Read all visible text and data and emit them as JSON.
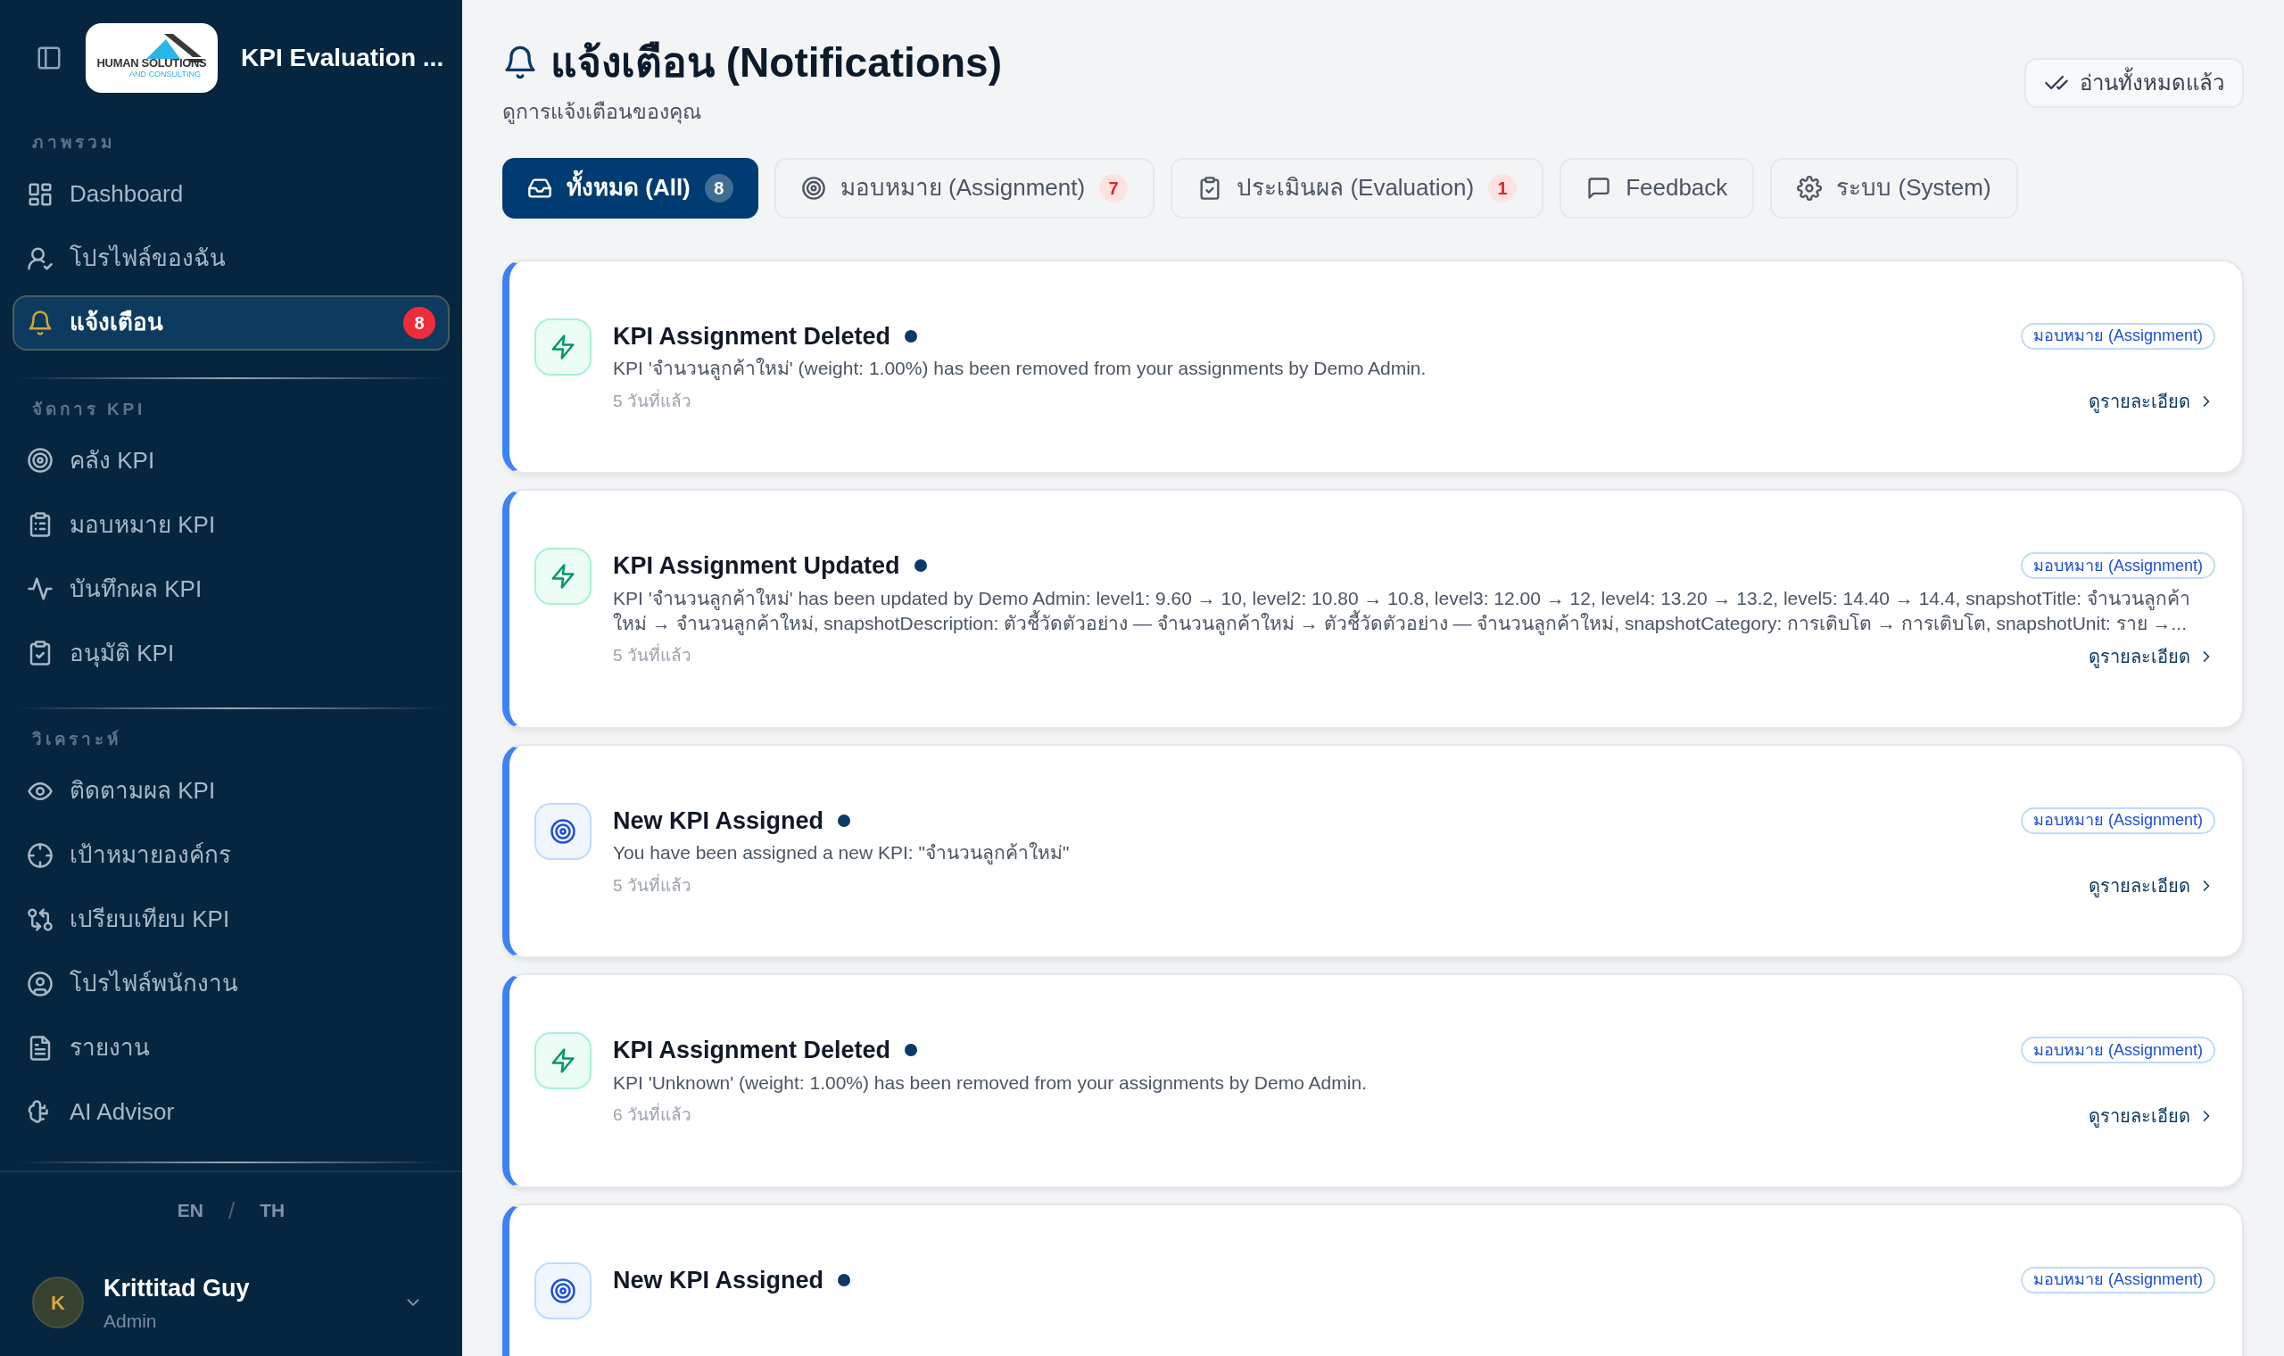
{
  "sidebar": {
    "logo": {
      "text": "HUMAN SOLUTIONS",
      "subtext": "AND CONSULTING"
    },
    "app_title": "KPI Evaluation ...",
    "sections": [
      {
        "label": "ภาพรวม",
        "items": [
          {
            "label": "Dashboard",
            "selected": false
          },
          {
            "label": "โปรไฟล์ของฉัน",
            "selected": false
          },
          {
            "label": "แจ้งเตือน",
            "selected": true,
            "badge": "8"
          }
        ]
      },
      {
        "label": "จัดการ KPI",
        "items": [
          {
            "label": "คลัง KPI",
            "selected": false
          },
          {
            "label": "มอบหมาย KPI",
            "selected": false
          },
          {
            "label": "บันทึกผล KPI",
            "selected": false
          },
          {
            "label": "อนุมัติ KPI",
            "selected": false
          }
        ]
      },
      {
        "label": "วิเคราะห์",
        "items": [
          {
            "label": "ติดตามผล KPI",
            "selected": false
          },
          {
            "label": "เป้าหมายองค์กร",
            "selected": false
          },
          {
            "label": "เปรียบเทียบ KPI",
            "selected": false
          },
          {
            "label": "โปรไฟล์พนักงาน",
            "selected": false
          },
          {
            "label": "รายงาน",
            "selected": false
          },
          {
            "label": "AI Advisor",
            "selected": false
          }
        ]
      }
    ],
    "languages": [
      {
        "label": "EN"
      },
      {
        "label": "/"
      },
      {
        "label": "TH"
      }
    ],
    "user": {
      "initial": "K",
      "name": "Krittitad Guy",
      "role": "Admin"
    }
  },
  "header": {
    "title": "แจ้งเตือน (Notifications)",
    "subtitle": "ดูการแจ้งเตือนของคุณ",
    "mark_all_button": "อ่านทั้งหมดแล้ว"
  },
  "tabs": [
    {
      "label": "ทั้งหมด (All)",
      "count": "8",
      "selected": true
    },
    {
      "label": "มอบหมาย (Assignment)",
      "count": "7",
      "selected": false
    },
    {
      "label": "ประเมินผล (Evaluation)",
      "count": "1",
      "selected": false
    },
    {
      "label": "Feedback",
      "selected": false
    },
    {
      "label": "ระบบ (System)",
      "selected": false
    }
  ],
  "notifications": [
    {
      "kind": "change",
      "title": "KPI Assignment Deleted",
      "unread": true,
      "description": "KPI 'จำนวนลูกค้าใหม่' (weight: 1.00%) has been removed from your assignments by Demo Admin.",
      "time": "5 วันที่แล้ว",
      "tag": "มอบหมาย (Assignment)",
      "link": "ดูรายละเอียด"
    },
    {
      "kind": "change",
      "title": "KPI Assignment Updated",
      "unread": true,
      "description": "KPI 'จำนวนลูกค้าใหม่' has been updated by Demo Admin: level1: 9.60 → 10, level2: 10.80 → 10.8, level3: 12.00 → 12, level4: 13.20 → 13.2, level5: 14.40 → 14.4, snapshotTitle: จำนวนลูกค้าใหม่ → จำนวนลูกค้าใหม่, snapshotDescription: ตัวชี้วัดตัวอย่าง — จำนวนลูกค้าใหม่ → ตัวชี้วัดตัวอย่าง — จำนวนลูกค้าใหม่, snapshotCategory: การเติบโต → การเติบโต, snapshotUnit: ราย →...",
      "time": "5 วันที่แล้ว",
      "tag": "มอบหมาย (Assignment)",
      "link": "ดูรายละเอียด"
    },
    {
      "kind": "new",
      "title": "New KPI Assigned",
      "unread": true,
      "description": "You have been assigned a new KPI: \"จำนวนลูกค้าใหม่\"",
      "time": "5 วันที่แล้ว",
      "tag": "มอบหมาย (Assignment)",
      "link": "ดูรายละเอียด"
    },
    {
      "kind": "change",
      "title": "KPI Assignment Deleted",
      "unread": true,
      "description": "KPI 'Unknown' (weight: 1.00%) has been removed from your assignments by Demo Admin.",
      "time": "6 วันที่แล้ว",
      "tag": "มอบหมาย (Assignment)",
      "link": "ดูรายละเอียด"
    },
    {
      "kind": "new",
      "title": "New KPI Assigned",
      "unread": true,
      "tag": "มอบหมาย (Assignment)"
    }
  ]
}
